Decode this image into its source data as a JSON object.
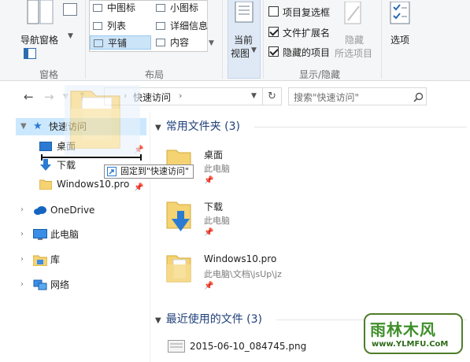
{
  "ribbon": {
    "pane_group": {
      "nav_pane_button": "导航窗格",
      "group_label": "窗格"
    },
    "layout_group": {
      "items": [
        "中图标",
        "小图标",
        "列表",
        "详细信息",
        "平铺",
        "内容"
      ],
      "selected": "平铺",
      "group_label": "布局"
    },
    "current_view": {
      "label_line1": "当前",
      "label_line2": "视图"
    },
    "show_hide_group": {
      "item_checkboxes": {
        "label": "项目复选框",
        "checked": false
      },
      "file_extensions": {
        "label": "文件扩展名",
        "checked": true
      },
      "hidden_items": {
        "label": "隐藏的项目",
        "checked": true
      },
      "hide_button_line1": "隐藏",
      "hide_button_line2": "所选项目",
      "group_label": "显示/隐藏"
    },
    "options_button": "选项"
  },
  "address_bar": {
    "path": "快速访问",
    "search_placeholder": "搜索\"快速访问\""
  },
  "nav_pane": {
    "quick_access": "快速访问",
    "pinned": [
      "桌面",
      "下载",
      "Windows10.pro"
    ],
    "onedrive": "OneDrive",
    "this_pc": "此电脑",
    "libraries": "库",
    "network": "网络"
  },
  "drag": {
    "tooltip": "固定到\"快速访问\""
  },
  "content": {
    "frequent_header": "常用文件夹 (3)",
    "frequent_folders": [
      {
        "name": "桌面",
        "location": "此电脑"
      },
      {
        "name": "下载",
        "location": "此电脑"
      },
      {
        "name": "Windows10.pro",
        "location": "此电脑\\文档\\jsUp\\jz"
      }
    ],
    "recent_header": "最近使用的文件 (3)",
    "recent_files": [
      {
        "name": "2015-06-10_084745.png"
      }
    ]
  },
  "watermark": {
    "title": "雨林木风",
    "url": "www.YLMFU.CoM"
  },
  "colors": {
    "selection": "#cce8ff",
    "folder": "#f5d272",
    "accent": "#1f3f7a",
    "download_arrow": "#2b7bd3"
  }
}
